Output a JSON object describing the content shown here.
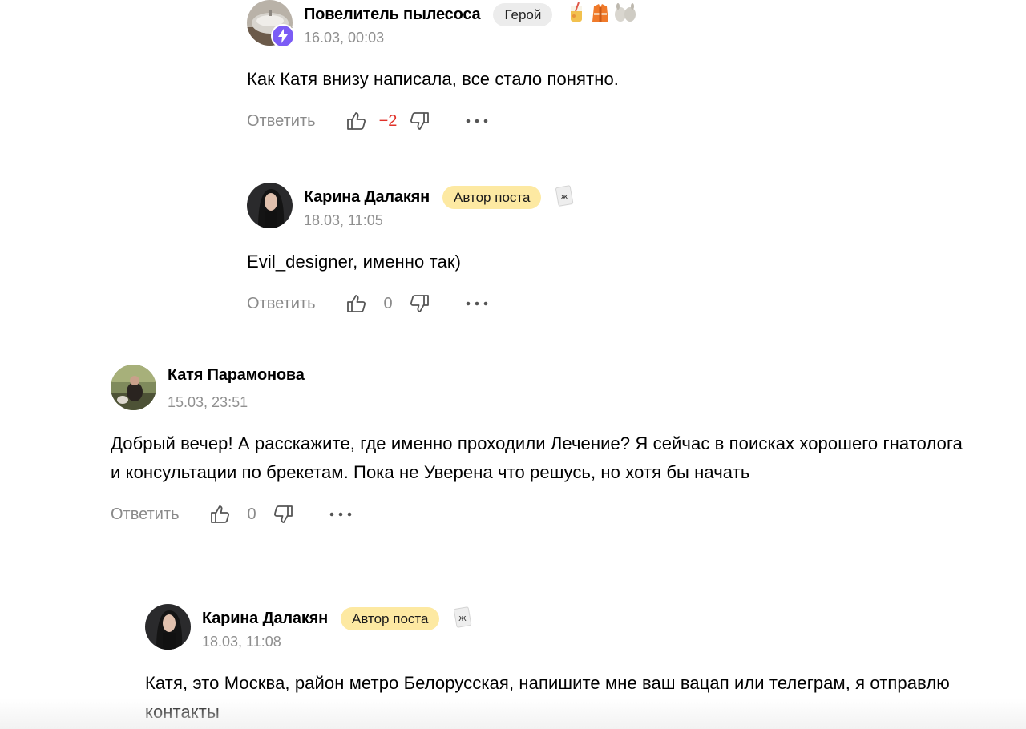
{
  "comments": [
    {
      "author": "Повелитель пылесоса",
      "tag": "Герой",
      "date": "16.03, 00:03",
      "text": "Как Катя внизу написала, все стало понятно.",
      "reply_label": "Ответить",
      "score": "−2",
      "badges": [
        "drink-icon",
        "life-vest-icon",
        "slippers-icon"
      ]
    },
    {
      "author": "Карина Далакян",
      "tag": "Автор поста",
      "date": "18.03, 11:05",
      "text": "Evil_designer, именно так)",
      "reply_label": "Ответить",
      "score": "0",
      "badges": [
        "card-icon"
      ]
    },
    {
      "author": "Катя Парамонова",
      "date": "15.03, 23:51",
      "text": "Добрый вечер! А расскажите, где именно проходили Лечение? Я сейчас в поисках хорошего гнатолога и консультации по брекетам. Пока не Уверена что решусь, но хотя бы начать",
      "reply_label": "Ответить",
      "score": "0"
    },
    {
      "author": "Карина Далакян",
      "tag": "Автор поста",
      "date": "18.03, 11:08",
      "text": "Катя, это Москва, район метро Белорусская, напишите мне ваш вацап или телеграм, я отправлю контакты",
      "badges": [
        "card-icon"
      ]
    }
  ],
  "colors": {
    "negative_score": "#e0322a",
    "author_tag_bg": "#fde9a2",
    "hero_tag_bg": "#ececec",
    "muted_text": "#8a8a8a",
    "bolt_badge": "#7b5cf5"
  }
}
